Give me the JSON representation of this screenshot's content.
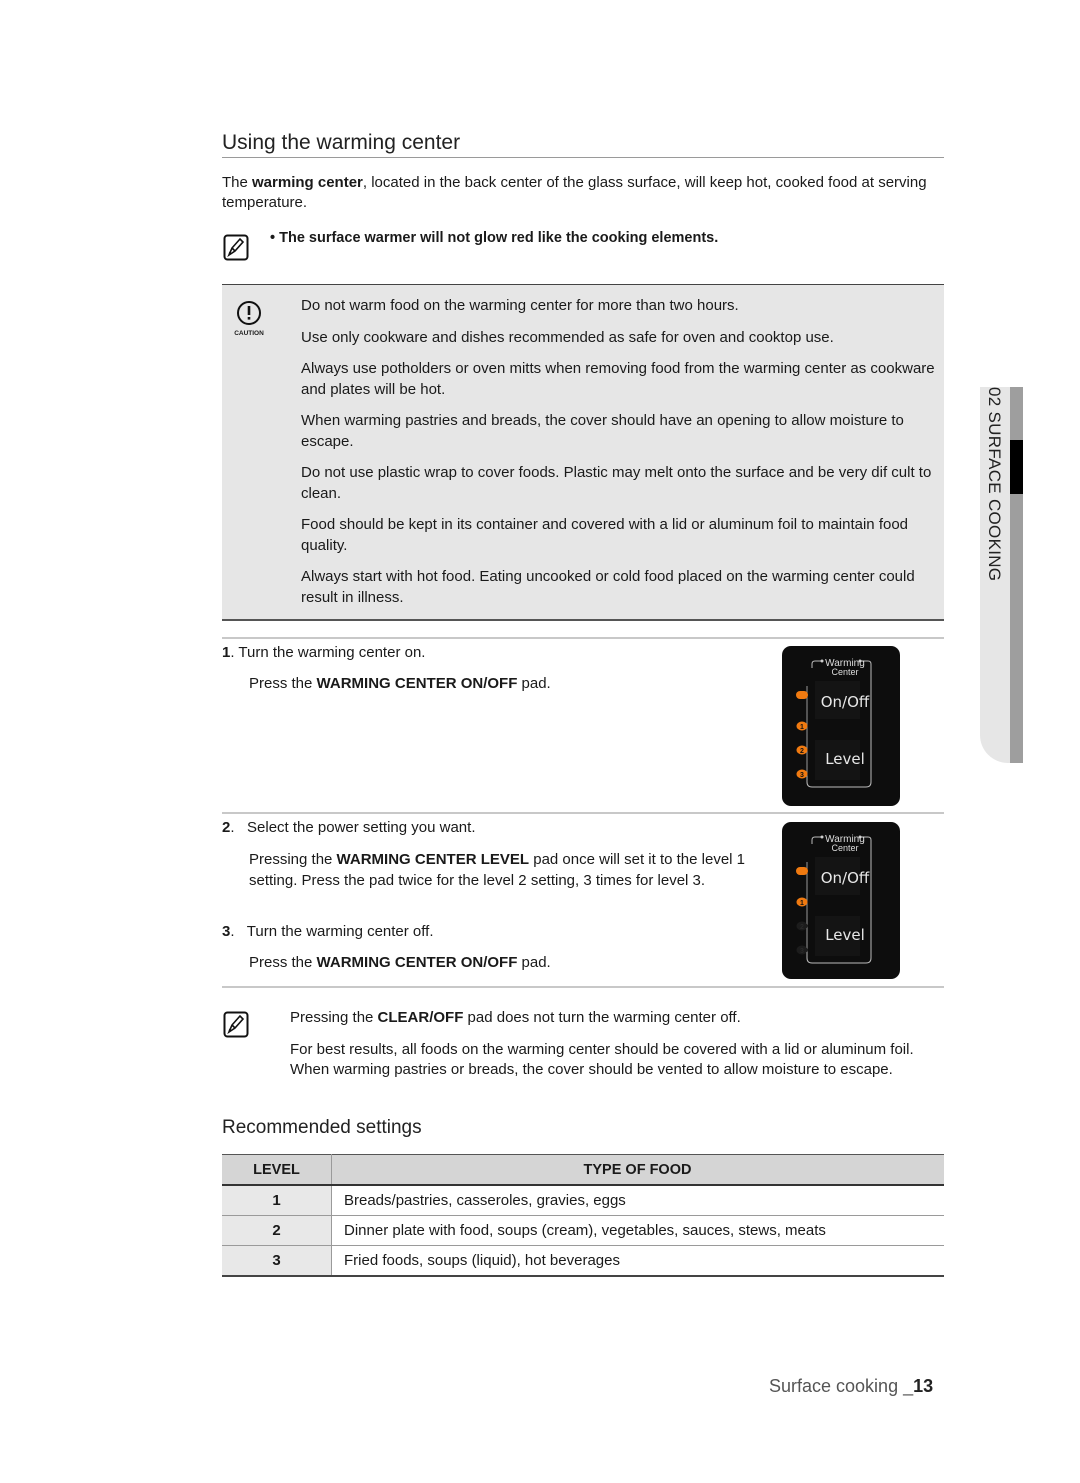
{
  "page": {
    "title": "Using the warming center",
    "intro": {
      "prefix": "The ",
      "bold": "warming center",
      "suffix": ", located in the back center of the glass surface, will keep hot, cooked food at serving temperature."
    },
    "note_top": "The surface warmer will not glow red like the cooking elements.",
    "caution": {
      "icon_label": "CAUTION",
      "items": [
        "Do not warm food on the warming center for more than two hours.",
        "Use only cookware and dishes recommended as safe for oven and cooktop use.",
        "Always use potholders or oven mitts when removing food from the warming center as cookware and plates will be hot.",
        "When warming pastries and breads, the cover should have an opening to allow moisture to escape.",
        "Do not use plastic wrap to cover foods. Plastic may melt onto the surface and be very dif cult to clean.",
        "Food should be kept in its container and covered with a lid or aluminum foil to maintain food quality.",
        "Always start with hot food. Eating uncooked or cold food placed on the warming center could result in illness."
      ]
    },
    "steps": [
      {
        "num": "1",
        "text": "Turn the warming center on.",
        "sub_prefix": "Press the ",
        "sub_bold": "WARMING CENTER ON/OFF",
        "sub_suffix": " pad."
      },
      {
        "num": "2",
        "text": "Select the power setting you want.",
        "sub_prefix": "Pressing the ",
        "sub_bold": "WARMING CENTER LEVEL",
        "sub_suffix": " pad once will set it to the level 1 setting. Press the pad twice for the level 2 setting, 3 times for level 3."
      },
      {
        "num": "3",
        "text": "Turn the warming center off.",
        "sub_prefix": "Press the ",
        "sub_bold": "WARMING CENTER ON/OFF",
        "sub_suffix": " pad."
      }
    ],
    "panels": [
      {
        "header_line1": "Warming",
        "header_line2": "Center",
        "onoff_label": "On/Off",
        "level_label": "Level",
        "power_lit": true,
        "levels_lit": [
          true,
          true,
          true
        ]
      },
      {
        "header_line1": "Warming",
        "header_line2": "Center",
        "onoff_label": "On/Off",
        "level_label": "Level",
        "power_lit": true,
        "levels_lit": [
          true,
          false,
          false
        ]
      }
    ],
    "note_bottom": {
      "line1_prefix": "Pressing the ",
      "line1_bold": "CLEAR/OFF",
      "line1_suffix": " pad does not turn the warming center off.",
      "line2": "For best results, all foods on the warming center should be covered with a lid or aluminum foil. When warming pastries or breads, the cover should be vented to allow moisture to escape."
    },
    "recommended": {
      "title": "Recommended settings",
      "headers": [
        "LEVEL",
        "TYPE OF FOOD"
      ],
      "rows": [
        {
          "level": "1",
          "food": "Breads/pastries, casseroles, gravies, eggs"
        },
        {
          "level": "2",
          "food": "Dinner plate with food, soups (cream), vegetables, sauces, stews, meats"
        },
        {
          "level": "3",
          "food": "Fried foods, soups (liquid), hot beverages"
        }
      ]
    },
    "side_tab": "02  SURFACE COOKING",
    "footer": {
      "section": "Surface cooking _",
      "page_number": "13"
    },
    "colors": {
      "indicator_on": "#f07a10",
      "indicator_off": "#1c1c1c",
      "caution_bg": "#e6e6e6"
    }
  }
}
